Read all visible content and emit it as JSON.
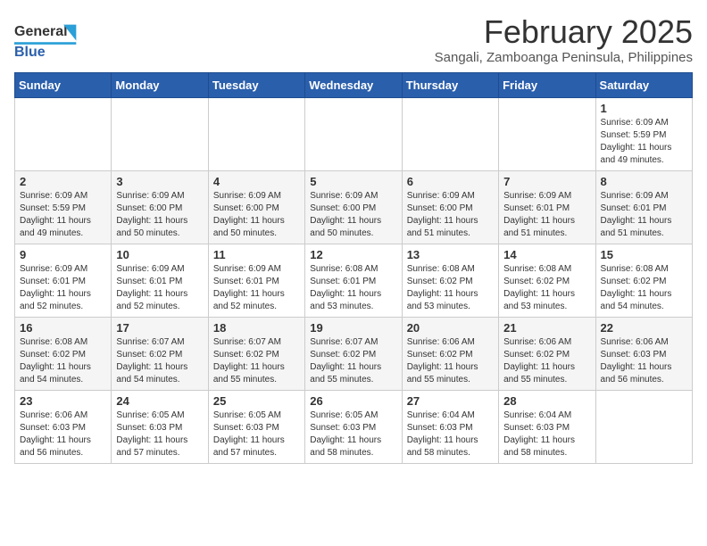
{
  "header": {
    "logo_general": "General",
    "logo_blue": "Blue",
    "month": "February 2025",
    "location": "Sangali, Zamboanga Peninsula, Philippines"
  },
  "calendar": {
    "days_of_week": [
      "Sunday",
      "Monday",
      "Tuesday",
      "Wednesday",
      "Thursday",
      "Friday",
      "Saturday"
    ],
    "weeks": [
      [
        {
          "day": "",
          "info": ""
        },
        {
          "day": "",
          "info": ""
        },
        {
          "day": "",
          "info": ""
        },
        {
          "day": "",
          "info": ""
        },
        {
          "day": "",
          "info": ""
        },
        {
          "day": "",
          "info": ""
        },
        {
          "day": "1",
          "info": "Sunrise: 6:09 AM\nSunset: 5:59 PM\nDaylight: 11 hours\nand 49 minutes."
        }
      ],
      [
        {
          "day": "2",
          "info": "Sunrise: 6:09 AM\nSunset: 5:59 PM\nDaylight: 11 hours\nand 49 minutes."
        },
        {
          "day": "3",
          "info": "Sunrise: 6:09 AM\nSunset: 6:00 PM\nDaylight: 11 hours\nand 50 minutes."
        },
        {
          "day": "4",
          "info": "Sunrise: 6:09 AM\nSunset: 6:00 PM\nDaylight: 11 hours\nand 50 minutes."
        },
        {
          "day": "5",
          "info": "Sunrise: 6:09 AM\nSunset: 6:00 PM\nDaylight: 11 hours\nand 50 minutes."
        },
        {
          "day": "6",
          "info": "Sunrise: 6:09 AM\nSunset: 6:00 PM\nDaylight: 11 hours\nand 51 minutes."
        },
        {
          "day": "7",
          "info": "Sunrise: 6:09 AM\nSunset: 6:01 PM\nDaylight: 11 hours\nand 51 minutes."
        },
        {
          "day": "8",
          "info": "Sunrise: 6:09 AM\nSunset: 6:01 PM\nDaylight: 11 hours\nand 51 minutes."
        }
      ],
      [
        {
          "day": "9",
          "info": "Sunrise: 6:09 AM\nSunset: 6:01 PM\nDaylight: 11 hours\nand 52 minutes."
        },
        {
          "day": "10",
          "info": "Sunrise: 6:09 AM\nSunset: 6:01 PM\nDaylight: 11 hours\nand 52 minutes."
        },
        {
          "day": "11",
          "info": "Sunrise: 6:09 AM\nSunset: 6:01 PM\nDaylight: 11 hours\nand 52 minutes."
        },
        {
          "day": "12",
          "info": "Sunrise: 6:08 AM\nSunset: 6:01 PM\nDaylight: 11 hours\nand 53 minutes."
        },
        {
          "day": "13",
          "info": "Sunrise: 6:08 AM\nSunset: 6:02 PM\nDaylight: 11 hours\nand 53 minutes."
        },
        {
          "day": "14",
          "info": "Sunrise: 6:08 AM\nSunset: 6:02 PM\nDaylight: 11 hours\nand 53 minutes."
        },
        {
          "day": "15",
          "info": "Sunrise: 6:08 AM\nSunset: 6:02 PM\nDaylight: 11 hours\nand 54 minutes."
        }
      ],
      [
        {
          "day": "16",
          "info": "Sunrise: 6:08 AM\nSunset: 6:02 PM\nDaylight: 11 hours\nand 54 minutes."
        },
        {
          "day": "17",
          "info": "Sunrise: 6:07 AM\nSunset: 6:02 PM\nDaylight: 11 hours\nand 54 minutes."
        },
        {
          "day": "18",
          "info": "Sunrise: 6:07 AM\nSunset: 6:02 PM\nDaylight: 11 hours\nand 55 minutes."
        },
        {
          "day": "19",
          "info": "Sunrise: 6:07 AM\nSunset: 6:02 PM\nDaylight: 11 hours\nand 55 minutes."
        },
        {
          "day": "20",
          "info": "Sunrise: 6:06 AM\nSunset: 6:02 PM\nDaylight: 11 hours\nand 55 minutes."
        },
        {
          "day": "21",
          "info": "Sunrise: 6:06 AM\nSunset: 6:02 PM\nDaylight: 11 hours\nand 55 minutes."
        },
        {
          "day": "22",
          "info": "Sunrise: 6:06 AM\nSunset: 6:03 PM\nDaylight: 11 hours\nand 56 minutes."
        }
      ],
      [
        {
          "day": "23",
          "info": "Sunrise: 6:06 AM\nSunset: 6:03 PM\nDaylight: 11 hours\nand 56 minutes."
        },
        {
          "day": "24",
          "info": "Sunrise: 6:05 AM\nSunset: 6:03 PM\nDaylight: 11 hours\nand 57 minutes."
        },
        {
          "day": "25",
          "info": "Sunrise: 6:05 AM\nSunset: 6:03 PM\nDaylight: 11 hours\nand 57 minutes."
        },
        {
          "day": "26",
          "info": "Sunrise: 6:05 AM\nSunset: 6:03 PM\nDaylight: 11 hours\nand 58 minutes."
        },
        {
          "day": "27",
          "info": "Sunrise: 6:04 AM\nSunset: 6:03 PM\nDaylight: 11 hours\nand 58 minutes."
        },
        {
          "day": "28",
          "info": "Sunrise: 6:04 AM\nSunset: 6:03 PM\nDaylight: 11 hours\nand 58 minutes."
        },
        {
          "day": "",
          "info": ""
        }
      ]
    ]
  }
}
